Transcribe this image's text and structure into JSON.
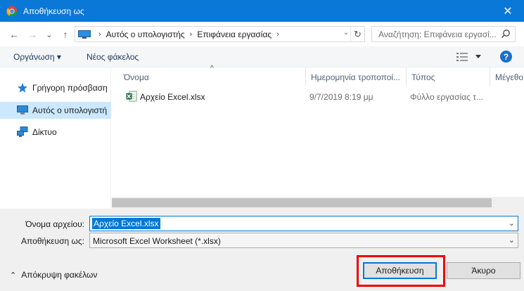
{
  "window": {
    "title": "Αποθήκευση ως",
    "close_glyph": "✕"
  },
  "nav": {
    "back": "←",
    "forward": "→",
    "history": "⌄",
    "up": "↑"
  },
  "address": {
    "crumbs": [
      "Αυτός ο υπολογιστής",
      "Επιφάνεια εργασίας"
    ],
    "separator": "›",
    "dropdown": "⌄",
    "refresh": "↻"
  },
  "search": {
    "placeholder": "Αναζήτηση: Επιφάνεια εργασί..."
  },
  "commands": {
    "organize": "Οργάνωση ▾",
    "new_folder": "Νέος φάκελος",
    "help": "?"
  },
  "sidebar": {
    "items": [
      {
        "label": "Γρήγορη πρόσβαση",
        "icon": "star-icon",
        "color": "#1f7fd6"
      },
      {
        "label": "Αυτός ο υπολογιστή",
        "icon": "computer-icon",
        "color": "#2a8ad6",
        "selected": true
      },
      {
        "label": "Δίκτυο",
        "icon": "network-icon",
        "color": "#2a8ad6"
      }
    ]
  },
  "columns": {
    "name": "Όνομα",
    "date": "Ημερομηνία τροποποί...",
    "type": "Τύπος",
    "size": "Μέγεθο",
    "sort_glyph": "^"
  },
  "files": [
    {
      "name": "Αρχείο Excel.xlsx",
      "date": "9/7/2019 8:19 μμ",
      "type": "Φύλλο εργασίας τ...",
      "icon": "excel-file-icon"
    }
  ],
  "form": {
    "filename_label": "Όνομα αρχείου:",
    "filename_value": "Αρχείο Excel.xlsx",
    "savetype_label": "Αποθήκευση ως:",
    "savetype_value": "Microsoft Excel Worksheet (*.xlsx)"
  },
  "footer": {
    "hide_folders": "Απόκρυψη φακέλων",
    "hide_chevron": "⌃",
    "save": "Αποθήκευση",
    "cancel": "Άκυρο"
  },
  "colors": {
    "titlebar": "#0a78d7",
    "accent": "#0078d7",
    "highlight": "#e00000",
    "selection": "#cce8ff"
  }
}
